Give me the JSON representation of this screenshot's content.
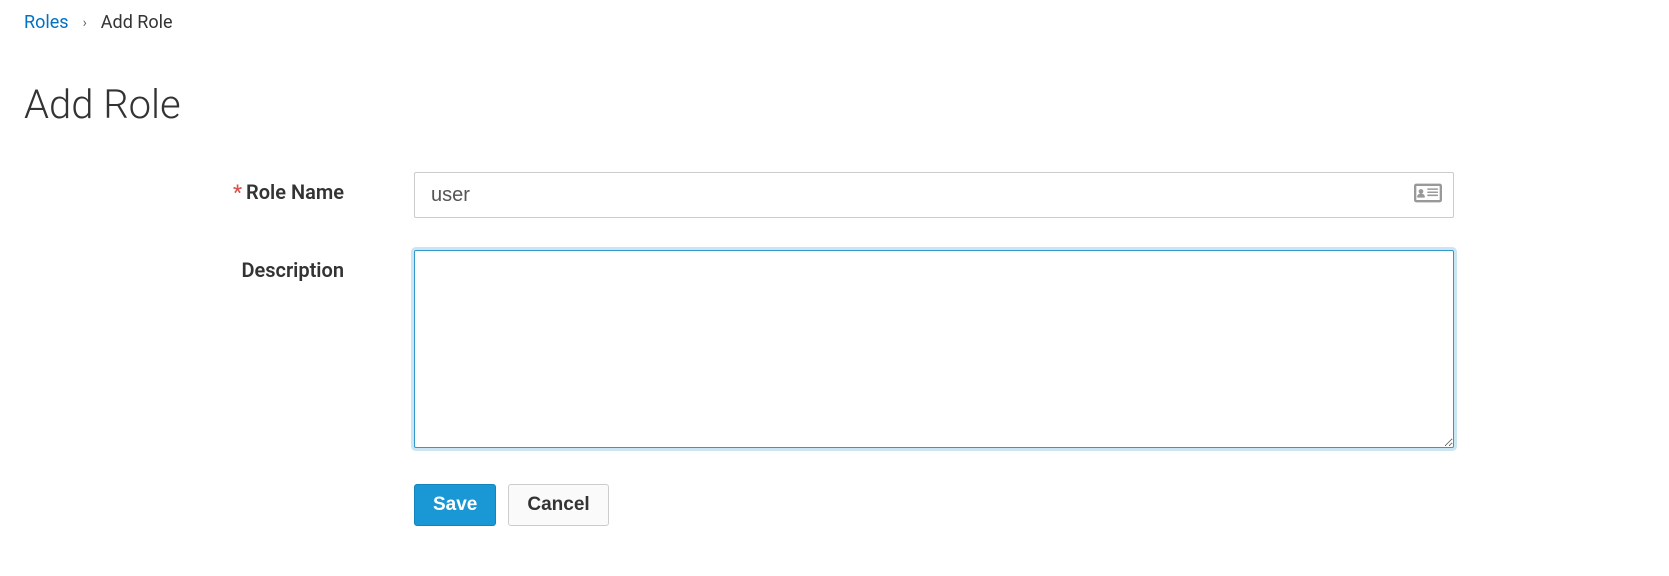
{
  "breadcrumb": {
    "parent": "Roles",
    "separator": "›",
    "current": "Add Role"
  },
  "header": {
    "title": "Add Role"
  },
  "form": {
    "role_name": {
      "label": "Role Name",
      "required_marker": "*",
      "value": "user"
    },
    "description": {
      "label": "Description",
      "value": ""
    }
  },
  "buttons": {
    "save": "Save",
    "cancel": "Cancel"
  }
}
